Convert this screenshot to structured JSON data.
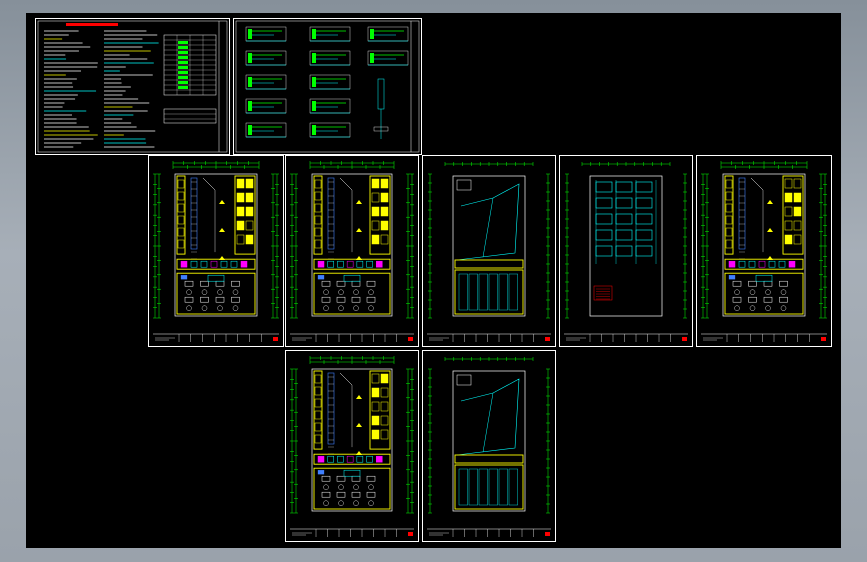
{
  "viewport": {
    "background": "#000000",
    "frame_color": "#9ba3ac"
  },
  "colors": {
    "border": "#ffffff",
    "dimension": "#00ff00",
    "wall": "#ffff00",
    "fill": "#ffff00",
    "outline": "#00ffff",
    "furniture": "#ffffff",
    "equipment": "#ff00ff",
    "note": "#ff0000",
    "stair": "#4080ff"
  },
  "sheets": [
    {
      "id": "sheet-design-notes",
      "kind": "notes",
      "number": ""
    },
    {
      "id": "sheet-details",
      "kind": "details",
      "number": ""
    },
    {
      "id": "sheet-floor-plan-1",
      "kind": "plan",
      "number": ""
    },
    {
      "id": "sheet-floor-plan-2",
      "kind": "plan",
      "number": ""
    },
    {
      "id": "sheet-site-outline-1",
      "kind": "outline",
      "number": ""
    },
    {
      "id": "sheet-grid-plan",
      "kind": "grid",
      "number": ""
    },
    {
      "id": "sheet-floor-plan-3",
      "kind": "plan",
      "number": ""
    },
    {
      "id": "sheet-floor-plan-4",
      "kind": "plan",
      "number": ""
    },
    {
      "id": "sheet-site-outline-2",
      "kind": "outline",
      "number": ""
    }
  ]
}
